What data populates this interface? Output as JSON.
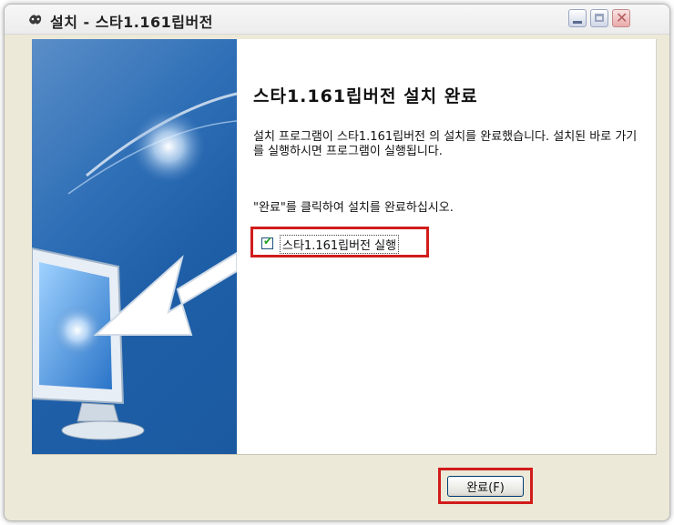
{
  "window": {
    "title": "설치 - 스타1.161립버전",
    "icon": "app-logo-icon",
    "controls": [
      "minimize-icon",
      "maximize-icon",
      "close-icon"
    ]
  },
  "content": {
    "heading": "스타1.161립버전 설치 완료",
    "description": "설치 프로그램이 스타1.161립버전 의 설치를 완료했습니다. 설치된 바로 가기를 실행하시면 프로그램이 실행됩니다.",
    "hint": "\"완료\"를 클릭하여 설치를 완료하십시오.",
    "run_option": {
      "label": "스타1.161립버전 실행",
      "checked": true
    }
  },
  "footer": {
    "finish_label": "완료(F)"
  },
  "colors": {
    "highlight": "#d11c1c",
    "panel_blue": "#2f6fb6",
    "dialog_bg": "#ece9d8"
  }
}
